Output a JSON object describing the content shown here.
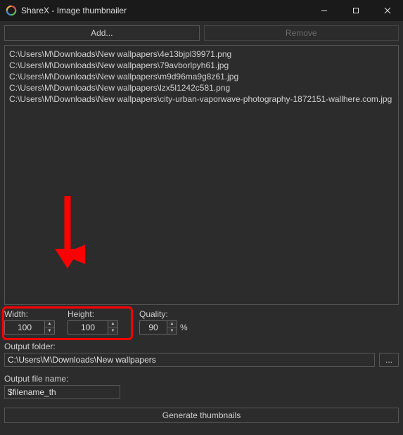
{
  "window": {
    "title": "ShareX - Image thumbnailer"
  },
  "buttons": {
    "add": "Add...",
    "remove": "Remove",
    "browse": "...",
    "generate": "Generate thumbnails"
  },
  "files": [
    "C:\\Users\\M\\Downloads\\New wallpapers\\4e13bjpl39971.png",
    "C:\\Users\\M\\Downloads\\New wallpapers\\79avborlpyh61.jpg",
    "C:\\Users\\M\\Downloads\\New wallpapers\\m9d96ma9g8z61.jpg",
    "C:\\Users\\M\\Downloads\\New wallpapers\\lzx5l1242c581.png",
    "C:\\Users\\M\\Downloads\\New wallpapers\\city-urban-vaporwave-photography-1872151-wallhere.com.jpg"
  ],
  "labels": {
    "width": "Width:",
    "height": "Height:",
    "quality": "Quality:",
    "percent": "%",
    "outputFolder": "Output folder:",
    "outputFilename": "Output file name:"
  },
  "values": {
    "width": "100",
    "height": "100",
    "quality": "90",
    "outputFolder": "C:\\Users\\M\\Downloads\\New wallpapers",
    "outputFilename": "$filename_th"
  },
  "colors": {
    "highlight": "#ff0000"
  }
}
